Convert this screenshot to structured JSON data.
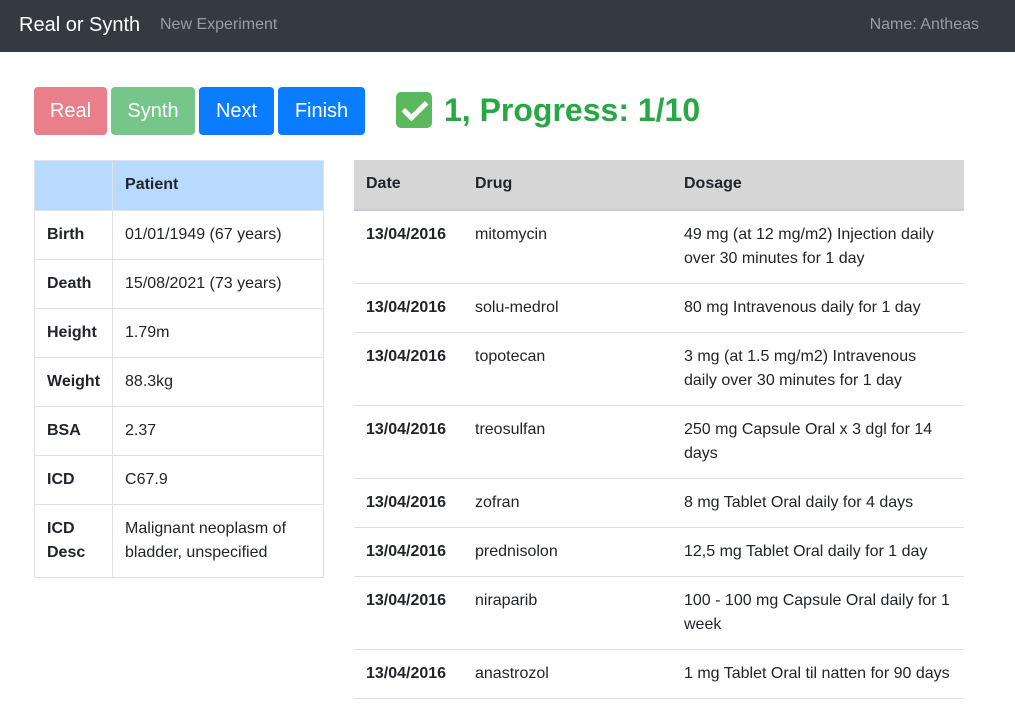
{
  "navbar": {
    "brand": "Real or Synth",
    "link": "New Experiment",
    "user": "Name: Antheas"
  },
  "buttons": {
    "real": "Real",
    "synth": "Synth",
    "next": "Next",
    "finish": "Finish"
  },
  "progress": {
    "text": "1, Progress: 1/10",
    "icon": "check-mark-button-icon",
    "color": "#28a745"
  },
  "patient_table": {
    "header": [
      "",
      "Patient"
    ],
    "rows": [
      {
        "label": "Birth",
        "value": "01/01/1949 (67 years)"
      },
      {
        "label": "Death",
        "value": "15/08/2021 (73 years)"
      },
      {
        "label": "Height",
        "value": "1.79m"
      },
      {
        "label": "Weight",
        "value": "88.3kg"
      },
      {
        "label": "BSA",
        "value": "2.37"
      },
      {
        "label": "ICD",
        "value": "C67.9"
      },
      {
        "label": "ICD Desc",
        "value": "Malignant neoplasm of bladder, unspecified"
      }
    ]
  },
  "drug_table": {
    "header": [
      "Date",
      "Drug",
      "Dosage"
    ],
    "rows": [
      {
        "date": "13/04/2016",
        "drug": "mitomycin",
        "dosage": "49 mg (at 12 mg/m2) Injection daily over 30 minutes for 1 day"
      },
      {
        "date": "13/04/2016",
        "drug": "solu-medrol",
        "dosage": "80 mg Intravenous daily for 1 day"
      },
      {
        "date": "13/04/2016",
        "drug": "topotecan",
        "dosage": "3 mg (at 1.5 mg/m2) Intravenous daily over 30 minutes for 1 day"
      },
      {
        "date": "13/04/2016",
        "drug": "treosulfan",
        "dosage": "250 mg Capsule Oral x 3 dgl for 14 days"
      },
      {
        "date": "13/04/2016",
        "drug": "zofran",
        "dosage": "8 mg Tablet Oral daily for 4 days"
      },
      {
        "date": "13/04/2016",
        "drug": "prednisolon",
        "dosage": "12,5 mg Tablet Oral daily for 1 day"
      },
      {
        "date": "13/04/2016",
        "drug": "niraparib",
        "dosage": "100 - 100 mg Capsule Oral daily for 1 week"
      },
      {
        "date": "13/04/2016",
        "drug": "anastrozol",
        "dosage": "1 mg Tablet Oral til natten for 90 days"
      }
    ]
  },
  "colors": {
    "navbar": "#343a40",
    "real": "#e97f8a",
    "synth": "#76c68b",
    "primary": "#0a7cff",
    "patient_header": "#b8daff",
    "drug_header": "#d6d6d6"
  }
}
